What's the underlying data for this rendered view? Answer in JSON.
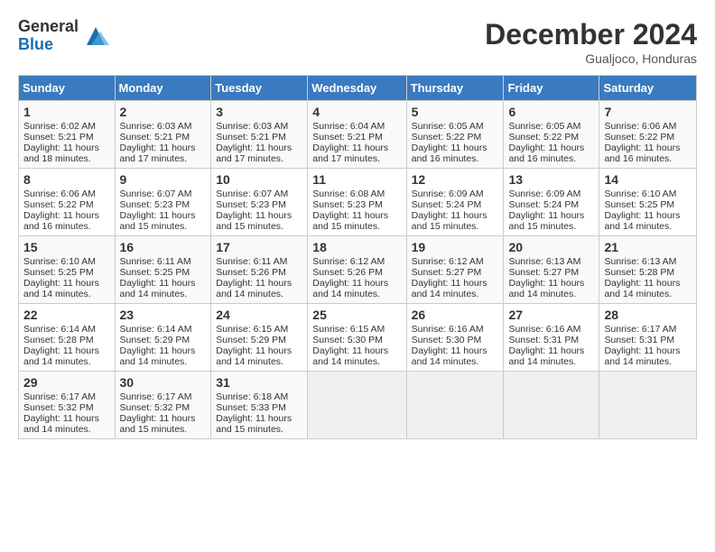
{
  "logo": {
    "general": "General",
    "blue": "Blue"
  },
  "title": "December 2024",
  "subtitle": "Gualjoco, Honduras",
  "days_of_week": [
    "Sunday",
    "Monday",
    "Tuesday",
    "Wednesday",
    "Thursday",
    "Friday",
    "Saturday"
  ],
  "weeks": [
    [
      {
        "day": "1",
        "info": "Sunrise: 6:02 AM\nSunset: 5:21 PM\nDaylight: 11 hours and 18 minutes."
      },
      {
        "day": "2",
        "info": "Sunrise: 6:03 AM\nSunset: 5:21 PM\nDaylight: 11 hours and 17 minutes."
      },
      {
        "day": "3",
        "info": "Sunrise: 6:03 AM\nSunset: 5:21 PM\nDaylight: 11 hours and 17 minutes."
      },
      {
        "day": "4",
        "info": "Sunrise: 6:04 AM\nSunset: 5:21 PM\nDaylight: 11 hours and 17 minutes."
      },
      {
        "day": "5",
        "info": "Sunrise: 6:05 AM\nSunset: 5:22 PM\nDaylight: 11 hours and 16 minutes."
      },
      {
        "day": "6",
        "info": "Sunrise: 6:05 AM\nSunset: 5:22 PM\nDaylight: 11 hours and 16 minutes."
      },
      {
        "day": "7",
        "info": "Sunrise: 6:06 AM\nSunset: 5:22 PM\nDaylight: 11 hours and 16 minutes."
      }
    ],
    [
      {
        "day": "8",
        "info": "Sunrise: 6:06 AM\nSunset: 5:22 PM\nDaylight: 11 hours and 16 minutes."
      },
      {
        "day": "9",
        "info": "Sunrise: 6:07 AM\nSunset: 5:23 PM\nDaylight: 11 hours and 15 minutes."
      },
      {
        "day": "10",
        "info": "Sunrise: 6:07 AM\nSunset: 5:23 PM\nDaylight: 11 hours and 15 minutes."
      },
      {
        "day": "11",
        "info": "Sunrise: 6:08 AM\nSunset: 5:23 PM\nDaylight: 11 hours and 15 minutes."
      },
      {
        "day": "12",
        "info": "Sunrise: 6:09 AM\nSunset: 5:24 PM\nDaylight: 11 hours and 15 minutes."
      },
      {
        "day": "13",
        "info": "Sunrise: 6:09 AM\nSunset: 5:24 PM\nDaylight: 11 hours and 15 minutes."
      },
      {
        "day": "14",
        "info": "Sunrise: 6:10 AM\nSunset: 5:25 PM\nDaylight: 11 hours and 14 minutes."
      }
    ],
    [
      {
        "day": "15",
        "info": "Sunrise: 6:10 AM\nSunset: 5:25 PM\nDaylight: 11 hours and 14 minutes."
      },
      {
        "day": "16",
        "info": "Sunrise: 6:11 AM\nSunset: 5:25 PM\nDaylight: 11 hours and 14 minutes."
      },
      {
        "day": "17",
        "info": "Sunrise: 6:11 AM\nSunset: 5:26 PM\nDaylight: 11 hours and 14 minutes."
      },
      {
        "day": "18",
        "info": "Sunrise: 6:12 AM\nSunset: 5:26 PM\nDaylight: 11 hours and 14 minutes."
      },
      {
        "day": "19",
        "info": "Sunrise: 6:12 AM\nSunset: 5:27 PM\nDaylight: 11 hours and 14 minutes."
      },
      {
        "day": "20",
        "info": "Sunrise: 6:13 AM\nSunset: 5:27 PM\nDaylight: 11 hours and 14 minutes."
      },
      {
        "day": "21",
        "info": "Sunrise: 6:13 AM\nSunset: 5:28 PM\nDaylight: 11 hours and 14 minutes."
      }
    ],
    [
      {
        "day": "22",
        "info": "Sunrise: 6:14 AM\nSunset: 5:28 PM\nDaylight: 11 hours and 14 minutes."
      },
      {
        "day": "23",
        "info": "Sunrise: 6:14 AM\nSunset: 5:29 PM\nDaylight: 11 hours and 14 minutes."
      },
      {
        "day": "24",
        "info": "Sunrise: 6:15 AM\nSunset: 5:29 PM\nDaylight: 11 hours and 14 minutes."
      },
      {
        "day": "25",
        "info": "Sunrise: 6:15 AM\nSunset: 5:30 PM\nDaylight: 11 hours and 14 minutes."
      },
      {
        "day": "26",
        "info": "Sunrise: 6:16 AM\nSunset: 5:30 PM\nDaylight: 11 hours and 14 minutes."
      },
      {
        "day": "27",
        "info": "Sunrise: 6:16 AM\nSunset: 5:31 PM\nDaylight: 11 hours and 14 minutes."
      },
      {
        "day": "28",
        "info": "Sunrise: 6:17 AM\nSunset: 5:31 PM\nDaylight: 11 hours and 14 minutes."
      }
    ],
    [
      {
        "day": "29",
        "info": "Sunrise: 6:17 AM\nSunset: 5:32 PM\nDaylight: 11 hours and 14 minutes."
      },
      {
        "day": "30",
        "info": "Sunrise: 6:17 AM\nSunset: 5:32 PM\nDaylight: 11 hours and 15 minutes."
      },
      {
        "day": "31",
        "info": "Sunrise: 6:18 AM\nSunset: 5:33 PM\nDaylight: 11 hours and 15 minutes."
      },
      {
        "day": "",
        "info": ""
      },
      {
        "day": "",
        "info": ""
      },
      {
        "day": "",
        "info": ""
      },
      {
        "day": "",
        "info": ""
      }
    ]
  ]
}
